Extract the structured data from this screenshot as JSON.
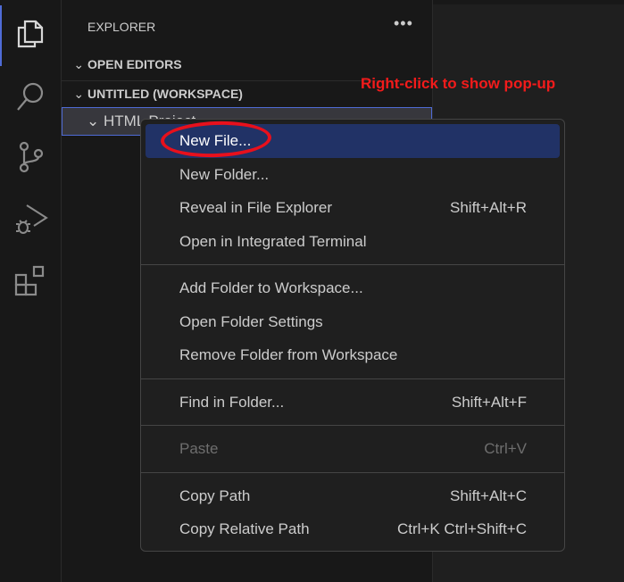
{
  "activity_bar": {
    "items": [
      {
        "icon": "files-icon",
        "active": true
      },
      {
        "icon": "search-icon"
      },
      {
        "icon": "source-control-icon"
      },
      {
        "icon": "run-debug-icon"
      },
      {
        "icon": "extensions-icon"
      }
    ]
  },
  "sidebar": {
    "title": "EXPLORER",
    "more_icon": "ellipsis-icon",
    "sections": [
      {
        "label": "OPEN EDITORS"
      },
      {
        "label": "UNTITLED (WORKSPACE)"
      }
    ],
    "folder": "HTML Project"
  },
  "context_menu": {
    "groups": [
      [
        {
          "label": "New File...",
          "shortcut": "",
          "selected": true
        },
        {
          "label": "New Folder...",
          "shortcut": ""
        },
        {
          "label": "Reveal in File Explorer",
          "shortcut": "Shift+Alt+R"
        },
        {
          "label": "Open in Integrated Terminal",
          "shortcut": ""
        }
      ],
      [
        {
          "label": "Add Folder to Workspace...",
          "shortcut": ""
        },
        {
          "label": "Open Folder Settings",
          "shortcut": ""
        },
        {
          "label": "Remove Folder from Workspace",
          "shortcut": ""
        }
      ],
      [
        {
          "label": "Find in Folder...",
          "shortcut": "Shift+Alt+F"
        }
      ],
      [
        {
          "label": "Paste",
          "shortcut": "Ctrl+V",
          "disabled": true
        }
      ],
      [
        {
          "label": "Copy Path",
          "shortcut": "Shift+Alt+C"
        },
        {
          "label": "Copy Relative Path",
          "shortcut": "Ctrl+K Ctrl+Shift+C"
        }
      ]
    ]
  },
  "annotation": {
    "text": "Right-click to show pop-up",
    "color": "#f31b1b"
  }
}
